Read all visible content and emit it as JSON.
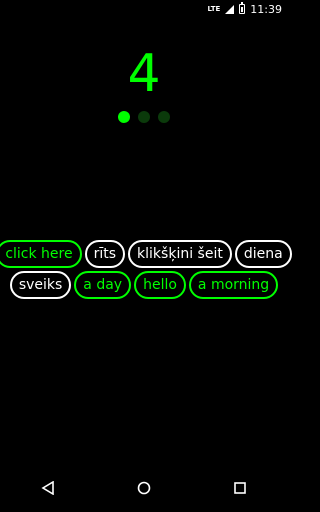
{
  "status_bar": {
    "network": "LTE",
    "time": "11:39"
  },
  "counter": {
    "value": "4"
  },
  "pager": {
    "total": 3,
    "active_index": 0
  },
  "chips": {
    "row1": [
      {
        "label": "click here",
        "style": "green"
      },
      {
        "label": "rīts",
        "style": "white"
      },
      {
        "label": "klikšķini šeit",
        "style": "white"
      },
      {
        "label": "diena",
        "style": "white"
      }
    ],
    "row2": [
      {
        "label": "sveiks",
        "style": "white"
      },
      {
        "label": "a day",
        "style": "green"
      },
      {
        "label": "hello",
        "style": "green"
      },
      {
        "label": "a morning",
        "style": "green"
      }
    ]
  },
  "colors": {
    "accent": "#00ff00",
    "inactive_dot": "#0b3a0b",
    "background": "#000000"
  },
  "nav": {
    "back_icon": "back-icon",
    "home_icon": "home-icon",
    "recents_icon": "recents-icon"
  }
}
